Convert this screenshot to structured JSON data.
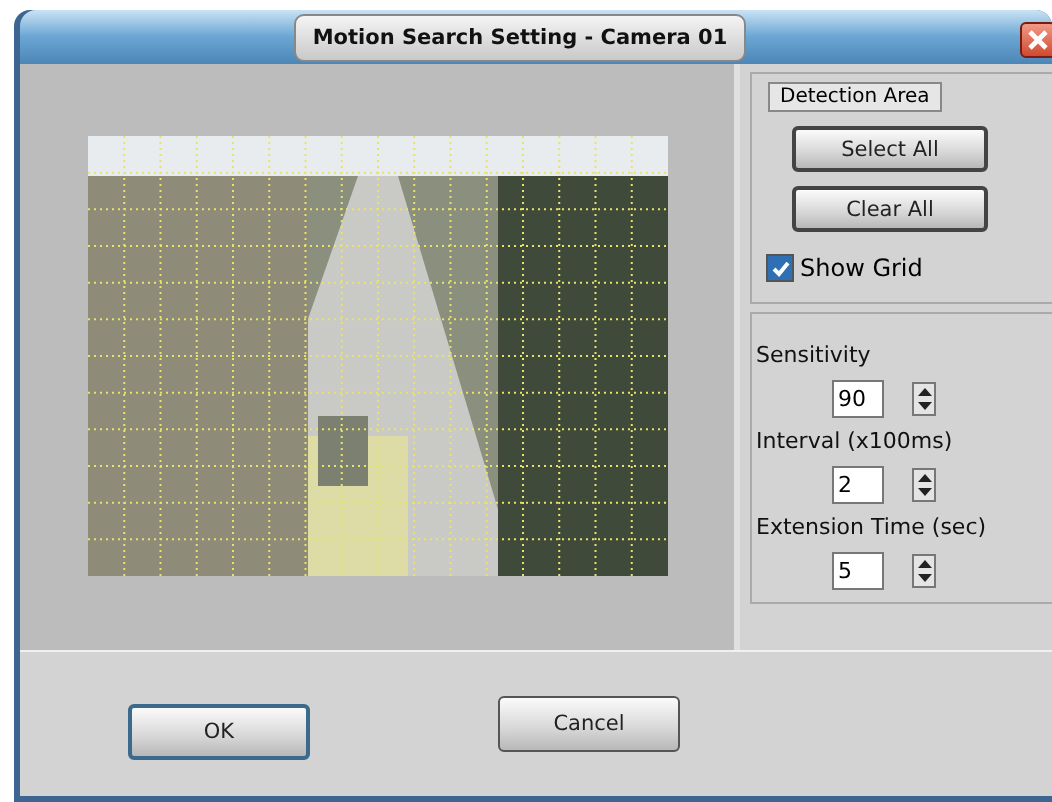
{
  "window": {
    "title": "Motion Search Setting - Camera 01"
  },
  "detection_area": {
    "label": "Detection Area",
    "buttons": [
      "Select All",
      "Clear All"
    ],
    "show_grid": {
      "label": "Show Grid",
      "checked": true
    }
  },
  "settings": [
    {
      "label": "Sensitivity",
      "value": "90"
    },
    {
      "label": "Interval (x100ms)",
      "value": "2"
    },
    {
      "label": "Extension Time (sec)",
      "value": "5"
    }
  ],
  "buttons": [
    {
      "label": "OK",
      "selected": true
    },
    {
      "label": "Cancel",
      "selected": false
    }
  ]
}
